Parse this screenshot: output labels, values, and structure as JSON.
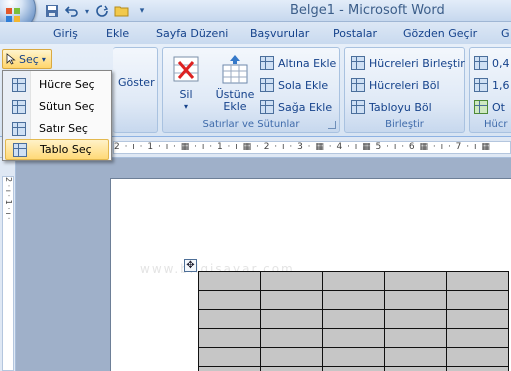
{
  "window": {
    "title": "Belge1 - Microsoft Word"
  },
  "tabs": [
    "Giriş",
    "Ekle",
    "Sayfa Düzeni",
    "Başvurular",
    "Postalar",
    "Gözden Geçir",
    "G"
  ],
  "ribbon": {
    "sec_button": "Seç",
    "goster": "Göster",
    "rows_cols_group": {
      "label": "Satırlar ve Sütunlar",
      "delete": "Sil",
      "insert_above_l1": "Üstüne",
      "insert_above_l2": "Ekle",
      "insert_below": "Altına Ekle",
      "insert_left": "Sola Ekle",
      "insert_right": "Sağa Ekle"
    },
    "merge_group": {
      "label": "Birleştir",
      "merge_cells": "Hücreleri Birleştir",
      "split_cells": "Hücreleri Böl",
      "split_table": "Tabloyu Böl"
    },
    "cell_group": {
      "label": "Hücr",
      "v1": "0,4",
      "v2": "1,6",
      "auto": "Ot"
    }
  },
  "sec_menu": {
    "items": [
      "Hücre Seç",
      "Sütun Seç",
      "Satır Seç",
      "Tablo Seç"
    ],
    "selected_index": 3
  },
  "ruler": {
    "text": "2 · ı · 1 · ı · ▦ · ı · 1 · ı ▦ · 2 · ı · 3 · ▦ · 4 · ı ▦ 5 · ı · 6 ▦ · ı · 7 · ı ▦"
  },
  "vruler": {
    "text": "2 · ı · 1 · ı ·"
  },
  "document": {
    "watermark": "www.bilgisayar.com",
    "table_rows": 6,
    "table_cols": 5
  },
  "colors": {
    "accent": "#15428b",
    "selected": "#ffd978",
    "table_fill": "#c6c6c6"
  }
}
